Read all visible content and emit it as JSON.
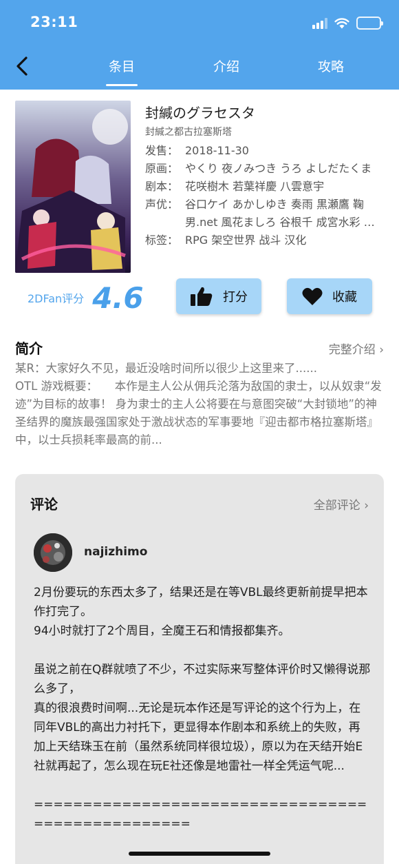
{
  "status_bar": {
    "time": "23:11"
  },
  "nav": {
    "tabs": [
      "条目",
      "介绍",
      "攻略"
    ],
    "active_tab": 0
  },
  "game": {
    "title": "封緘のグラセスタ",
    "subtitle": "封緘之都古拉塞斯塔",
    "fields": [
      {
        "key": "发售：",
        "value": "2018-11-30"
      },
      {
        "key": "原画：",
        "value": "やくり 夜ノみつき うろ よしだたくま"
      },
      {
        "key": "剧本：",
        "value": "花咲樹木 若葉祥慶 八雲意宇"
      },
      {
        "key": "声优：",
        "value": "谷口ケイ あかしゆき 奏雨 黒瀬鷹 鞠男.net 風花ましろ 谷根千 成宮水彩 …"
      },
      {
        "key": "标签：",
        "value": "RPG 架空世界 战斗 汉化"
      }
    ]
  },
  "rating": {
    "label": "2DFan评分",
    "score": "4.6"
  },
  "actions": {
    "rate_label": "打分",
    "favorite_label": "收藏"
  },
  "intro": {
    "title": "简介",
    "more_label": "完整介绍 ›",
    "text": "某R：大家好久不见，最近没啥时间所以很少上这里来了......\nOTL 游戏概要：　　本作是主人公从佣兵沦落为敌国的隶士，以从奴隶“发迹”为目标的故事！ 身为隶士的主人公将要在与意图突破“大封锁地”的神圣结界的魔族最强国家处于激战状态的军事要地『迎击都市格拉塞斯塔』中，以士兵损耗率最高的前..."
  },
  "comments": {
    "title": "评论",
    "more_label": "全部评论 ›",
    "items": [
      {
        "user": "najizhimo",
        "text": "2月份要玩的东西太多了，结果还是在等VBL最终更新前提早把本作打完了。\n94小时就打了2个周目，全魔王石和情报都集齐。\n\n虽说之前在Q群就喷了不少，不过实际来写整体评价时又懒得说那么多了，\n真的很浪费时间啊...无论是玩本作还是写评论的这个行为上，在同年VBL的高出力衬托下，更显得本作剧本和系统上的失败，再加上天结珠玉在前（虽然系统同样很垃圾），原以为在天结开始E社就再起了，怎么现在玩E社还像是地雷社一样全凭运气呢...\n\n=================================================="
      }
    ]
  },
  "colors": {
    "header": "#53a5ec",
    "accent": "#4aa0ea",
    "button": "#a7d6f8",
    "card": "#e6e6e6"
  }
}
